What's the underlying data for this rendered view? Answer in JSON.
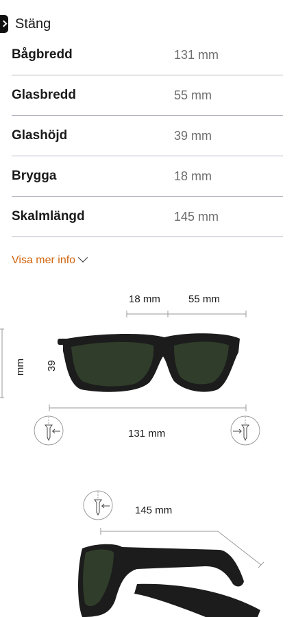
{
  "header": {
    "close_label": "Stäng"
  },
  "specs": [
    {
      "label": "Bågbredd",
      "value": "131 mm"
    },
    {
      "label": "Glasbredd",
      "value": "55 mm"
    },
    {
      "label": "Glashöjd",
      "value": "39 mm"
    },
    {
      "label": "Brygga",
      "value": "18 mm"
    },
    {
      "label": "Skalmlängd",
      "value": "145 mm"
    }
  ],
  "more": {
    "label": "Visa mer info"
  },
  "diagram": {
    "bridge_dim": "18 mm",
    "lens_width_dim": "55 mm",
    "lens_height_value": "39",
    "lens_height_unit": "mm",
    "frame_width_dim": "131 mm",
    "temple_dim": "145 mm"
  },
  "colors": {
    "link_orange": "#d1640e",
    "divider": "#b8b3c0"
  }
}
